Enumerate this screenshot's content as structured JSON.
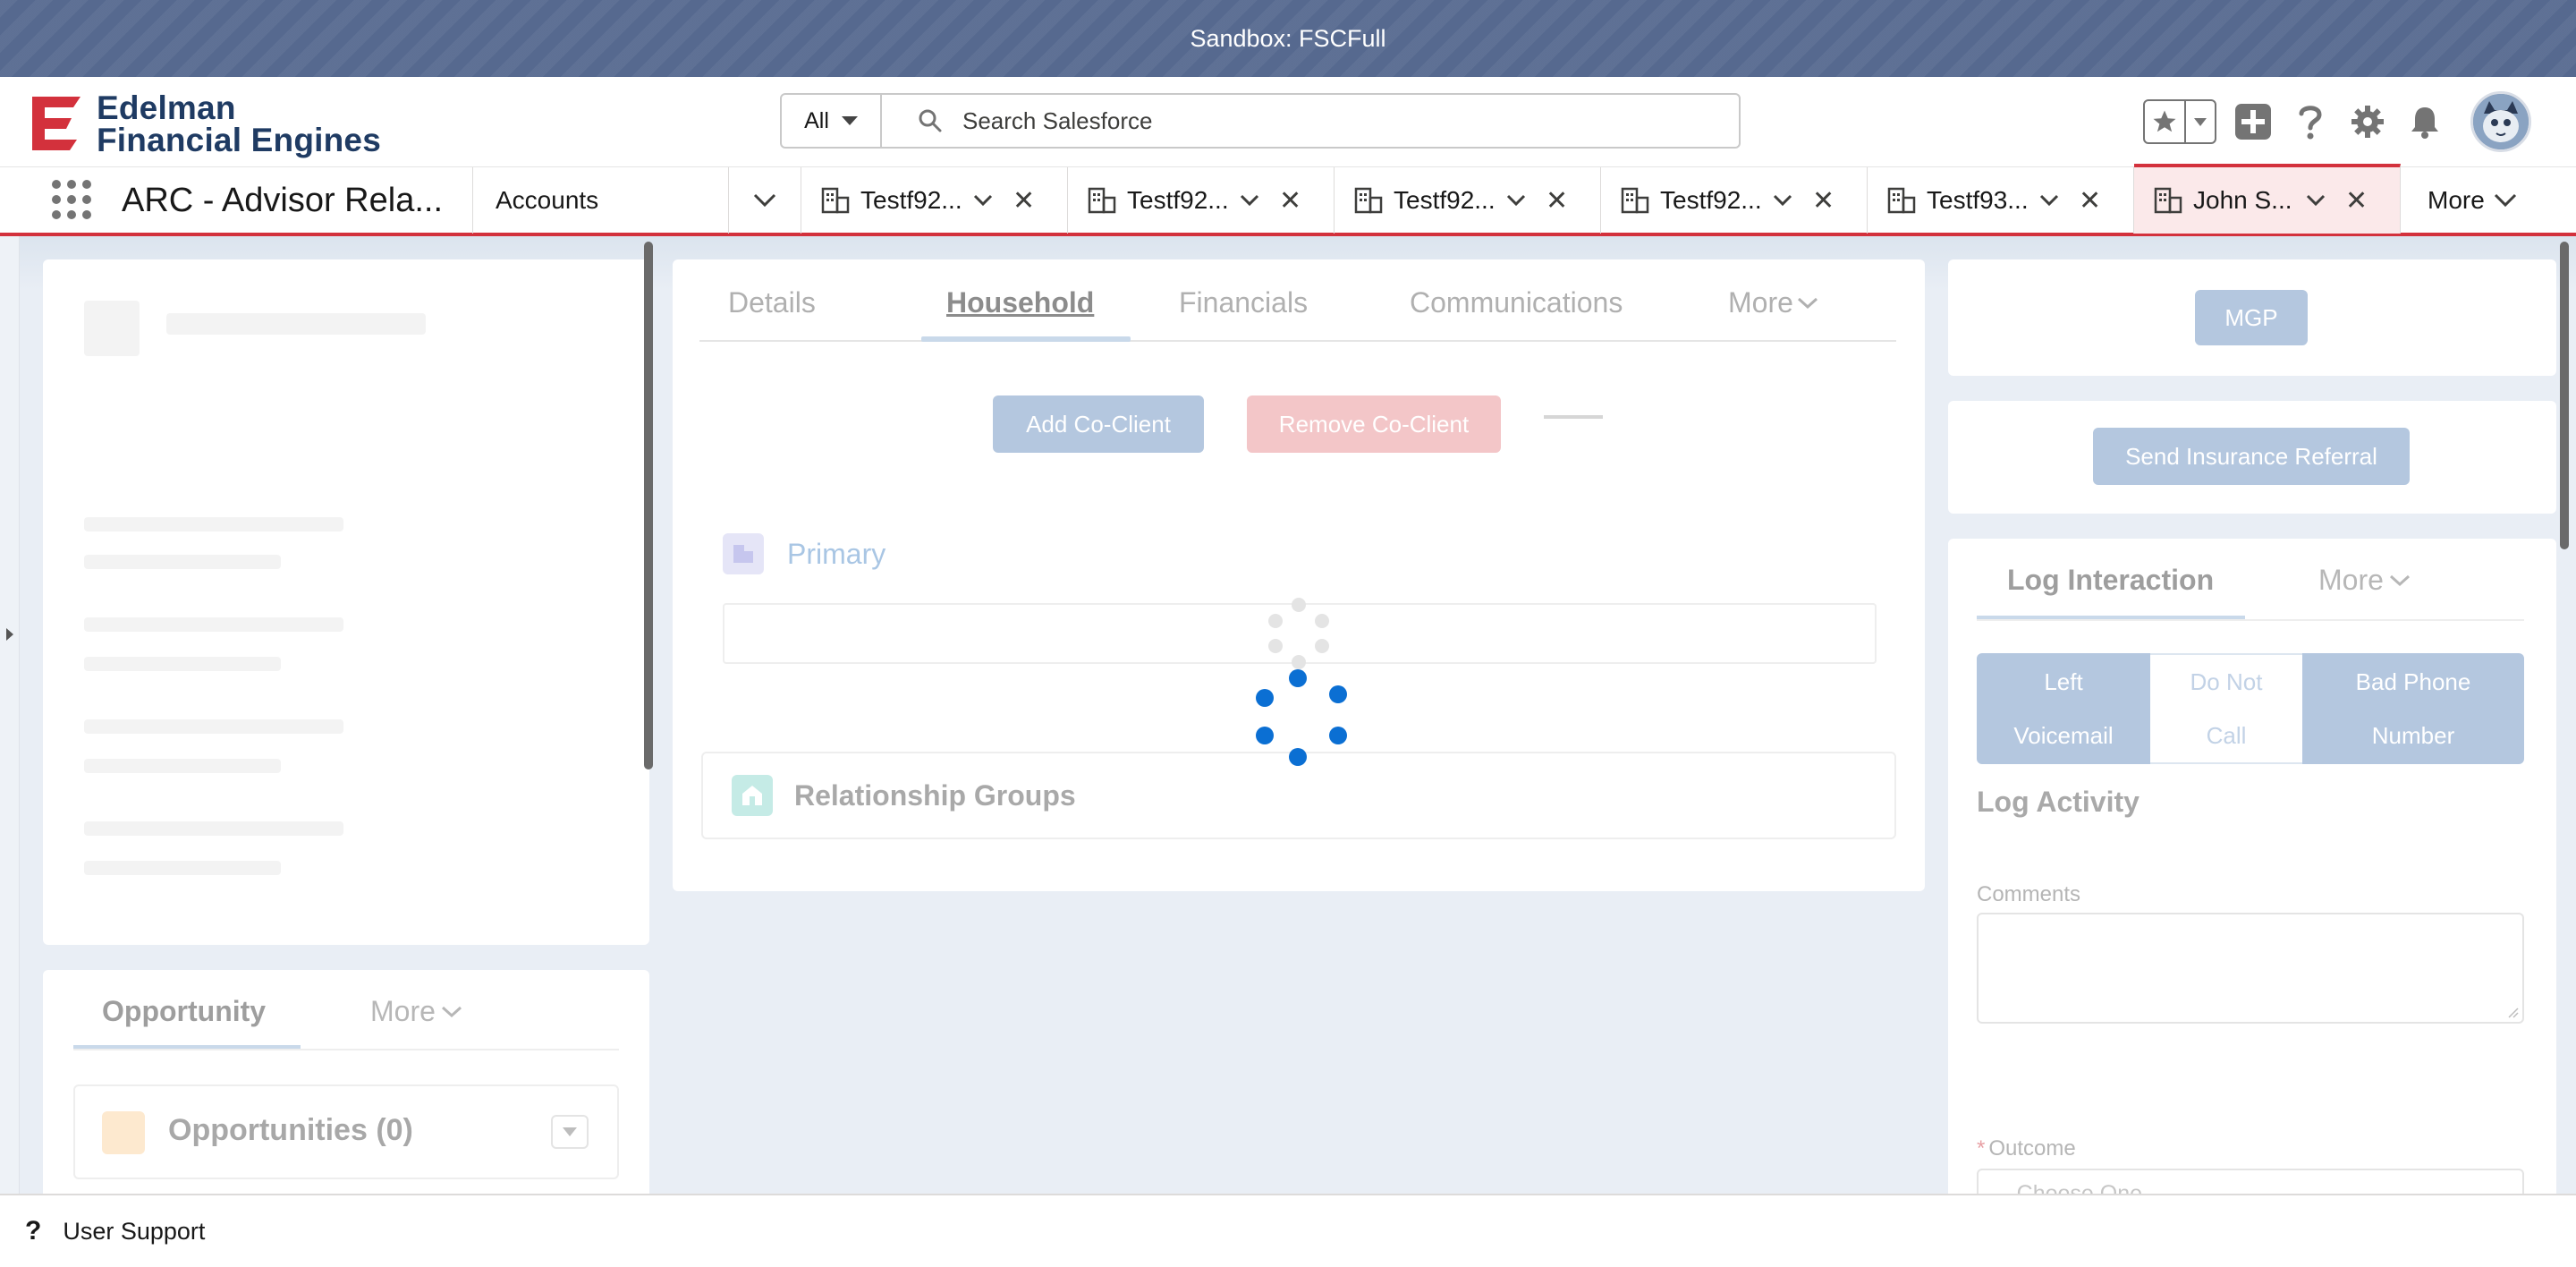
{
  "sandbox_banner": "Sandbox: FSCFull",
  "logo": {
    "line1": "Edelman",
    "line2": "Financial Engines",
    "brand_color": "#d3313c"
  },
  "search": {
    "scope": "All",
    "placeholder": "Search Salesforce"
  },
  "header_icons": [
    "favorites-star-icon",
    "favorites-list-icon",
    "global-actions-add-icon",
    "help-icon",
    "setup-gear-icon",
    "notifications-bell-icon",
    "user-avatar"
  ],
  "nav": {
    "app_name": "ARC - Advisor Rela...",
    "accounts": "Accounts",
    "tabs": [
      {
        "label": "Testf92..."
      },
      {
        "label": "Testf92..."
      },
      {
        "label": "Testf92..."
      },
      {
        "label": "Testf92..."
      },
      {
        "label": "Testf93..."
      },
      {
        "label": "John S..."
      }
    ],
    "more": "More"
  },
  "middle": {
    "tabs": [
      "Details",
      "Household",
      "Financials",
      "Communications",
      "More"
    ],
    "active_tab": "Household",
    "add_co_client": "Add Co-Client",
    "remove_co_client": "Remove Co-Client",
    "primary": "Primary",
    "relationship_groups": "Relationship Groups"
  },
  "left": {
    "opportunity_tab": "Opportunity",
    "more_tab": "More",
    "opportunities": "Opportunities (0)"
  },
  "right": {
    "mgp": "MGP",
    "send_insurance_referral": "Send Insurance Referral",
    "log_interaction_tab": "Log Interaction",
    "more_tab": "More",
    "left_voicemail": [
      "Left",
      "Voicemail"
    ],
    "do_not_call": [
      "Do Not",
      "Call"
    ],
    "bad_phone_number": [
      "Bad Phone",
      "Number"
    ],
    "log_activity": "Log Activity",
    "comments_label": "Comments",
    "outcome_required": "*",
    "outcome_label": "Outcome",
    "outcome_value": "--Choose One--"
  },
  "utility": {
    "user_support": "User Support"
  },
  "colors": {
    "brand_blue": "#0b6fd3",
    "accent_red": "#d3313c",
    "sandbox_banner": "#56698f"
  }
}
